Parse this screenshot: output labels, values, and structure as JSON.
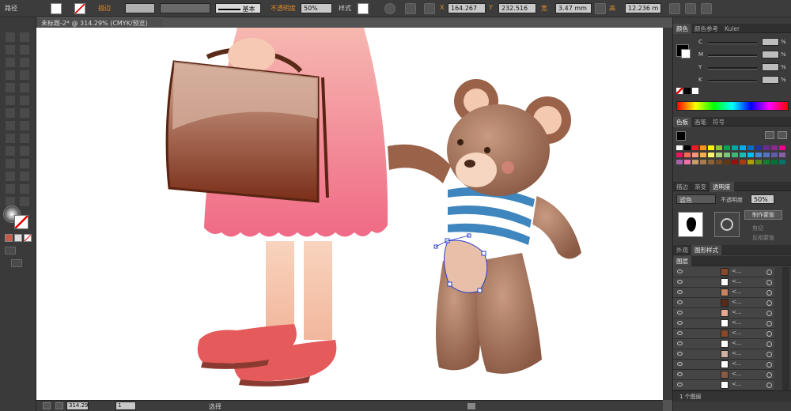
{
  "control_bar": {
    "object_type": "路径",
    "stroke_label": "描边",
    "stroke_style": "基本",
    "opacity_label": "不透明度",
    "opacity_value": "50%",
    "style_label": "样式",
    "x_label": "X",
    "x_value": "164.267",
    "y_label": "Y",
    "y_value": "232.516",
    "w_label": "宽",
    "w_value": "3.47 mm",
    "h_label": "高",
    "h_value": "12.236 m"
  },
  "document": {
    "tab_title": "未标题-2* @ 314.29% (CMYK/预览)"
  },
  "status_bar": {
    "zoom": "314.29",
    "page": "1",
    "mode": "选择"
  },
  "color_panel": {
    "tabs": [
      "颜色",
      "颜色参考",
      "Kuler"
    ],
    "channels": [
      "C",
      "M",
      "Y",
      "K"
    ],
    "values": [
      "%",
      "%",
      "%",
      "%"
    ]
  },
  "swatches_panel": {
    "tabs": [
      "色板",
      "画笔",
      "符号"
    ],
    "colors": [
      "#ffffff",
      "#000000",
      "#ed1c24",
      "#f7941d",
      "#fff200",
      "#8dc63f",
      "#00a651",
      "#00a99d",
      "#00aeef",
      "#0072bc",
      "#2e3192",
      "#662d91",
      "#92278f",
      "#ec008c",
      "#ed145b",
      "#f26c4f",
      "#f69679",
      "#fbad52",
      "#fff568",
      "#acd373",
      "#7cc576",
      "#3bb878",
      "#1abbb4",
      "#00bff3",
      "#448ccb",
      "#5674b9",
      "#605ca8",
      "#855fa8",
      "#a763a8",
      "#f06eaa",
      "#c69c6d",
      "#a67c52",
      "#8c6239",
      "#754c24",
      "#603913",
      "#9e0b0f",
      "#a0410d",
      "#aba000",
      "#598527",
      "#197b30",
      "#007236",
      "#00746b"
    ]
  },
  "transparency_panel": {
    "tabs": [
      "描边",
      "渐变",
      "透明度"
    ],
    "blend_mode": "滤色",
    "opacity_label": "不透明度",
    "opacity_value": "50%",
    "make_mask": "制作蒙版",
    "clip": "剪切",
    "invert_mask": "反相蒙版"
  },
  "appearance_panel": {
    "tabs": [
      "外观",
      "图形样式"
    ]
  },
  "layers_panel": {
    "tab": "图层",
    "rows": [
      "<...",
      "<...",
      "<...",
      "<...",
      "<...",
      "<...",
      "<...",
      "<...",
      "<...",
      "<...",
      "<...",
      "<..."
    ],
    "footer": "1 个图层"
  }
}
